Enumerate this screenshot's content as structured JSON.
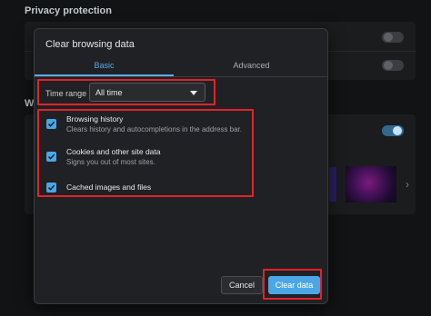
{
  "background": {
    "section_heading": "Privacy protection",
    "section2_fragment": "W",
    "toggles": [
      {
        "name": "privacy-toggle-1",
        "on": false
      },
      {
        "name": "privacy-toggle-2",
        "on": false
      },
      {
        "name": "wallpaper-toggle",
        "on": true
      }
    ],
    "chevron": "›"
  },
  "dialog": {
    "title": "Clear browsing data",
    "tabs": [
      {
        "label": "Basic",
        "active": true
      },
      {
        "label": "Advanced",
        "active": false
      }
    ],
    "time_range": {
      "label": "Time range",
      "selected": "All time"
    },
    "options": [
      {
        "title": "Browsing history",
        "description": "Clears history and autocompletions in the address bar.",
        "checked": true
      },
      {
        "title": "Cookies and other site data",
        "description": "Signs you out of most sites.",
        "checked": true
      },
      {
        "title": "Cached images and files",
        "description": "",
        "checked": true
      }
    ],
    "buttons": {
      "cancel": "Cancel",
      "clear": "Clear data"
    }
  },
  "colors": {
    "accent": "#4aa6e6",
    "highlight": "#e1232a",
    "dialog_bg": "#202124"
  }
}
